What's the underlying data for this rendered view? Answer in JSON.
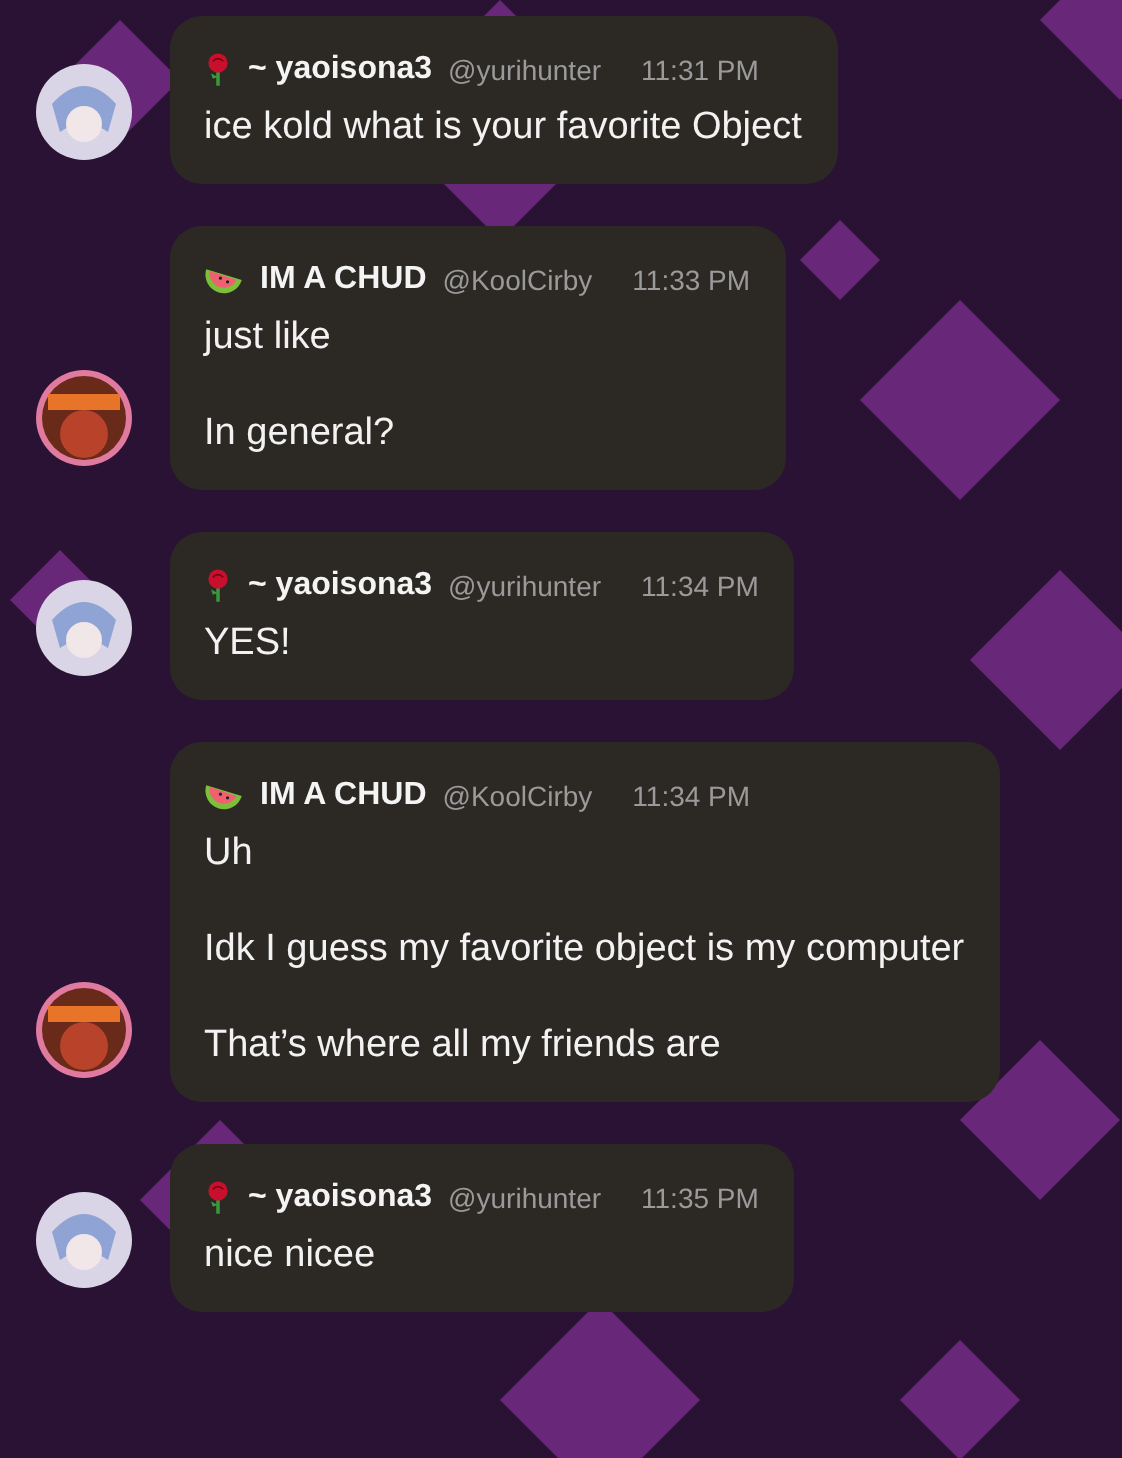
{
  "messages": [
    {
      "author": "~ yaoisona3",
      "kind": "rose",
      "handle": "@yurihunter",
      "time": "11:31 PM",
      "lines": [
        "ice kold what is your favorite Object"
      ]
    },
    {
      "author": "IM A CHUD",
      "kind": "watermelon",
      "handle": "@KoolCirby",
      "time": "11:33 PM",
      "lines": [
        "just like",
        "In general?"
      ]
    },
    {
      "author": "~ yaoisona3",
      "kind": "rose",
      "handle": "@yurihunter",
      "time": "11:34 PM",
      "lines": [
        "YES!"
      ]
    },
    {
      "author": "IM A CHUD",
      "kind": "watermelon",
      "handle": "@KoolCirby",
      "time": "11:34 PM",
      "lines": [
        "Uh",
        "Idk I guess my favorite object is my computer",
        "That’s where all my friends are"
      ]
    },
    {
      "author": "~ yaoisona3",
      "kind": "rose",
      "handle": "@yurihunter",
      "time": "11:35 PM",
      "lines": [
        "nice nicee"
      ]
    }
  ]
}
